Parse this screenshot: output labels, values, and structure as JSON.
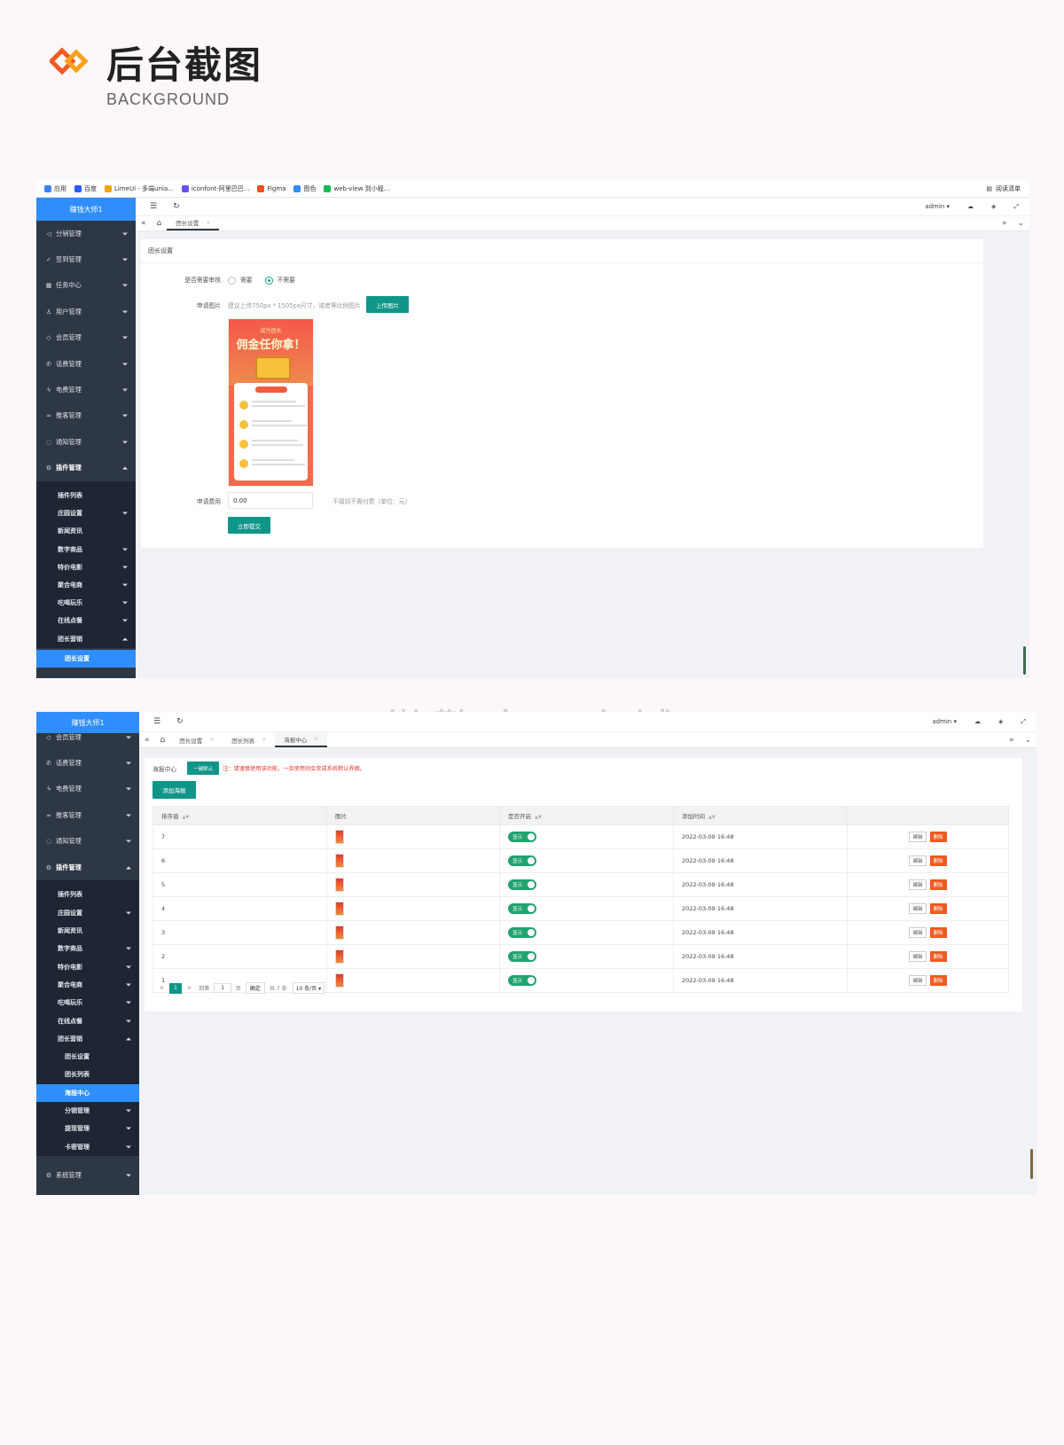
{
  "header": {
    "title": "后台截图",
    "subtitle": "BACKGROUND",
    "accent_colors": [
      "#f15a22",
      "#f7a11a"
    ]
  },
  "browser": {
    "bookmarks": [
      {
        "label": "应用",
        "color": "#3b82f6"
      },
      {
        "label": "百度",
        "color": "#2a59ff"
      },
      {
        "label": "LimeUi - 多端unia...",
        "color": "#f0a500"
      },
      {
        "label": "iconfont-阿里巴巴...",
        "color": "#6c4cf6"
      },
      {
        "label": "Figma",
        "color": "#f24e1e"
      },
      {
        "label": "图色",
        "color": "#2f8efb"
      },
      {
        "label": "web-view 到小程...",
        "color": "#19b955"
      }
    ],
    "reading_list": "阅读清单"
  },
  "shot1": {
    "sidebar": {
      "logo": "赚钱大师1",
      "items": [
        {
          "icon": "send-icon",
          "glyph": "◁",
          "label": "分销管理"
        },
        {
          "icon": "check-icon",
          "glyph": "✓",
          "label": "签到管理"
        },
        {
          "icon": "calendar-icon",
          "glyph": "▦",
          "label": "任务中心"
        },
        {
          "icon": "user-icon",
          "glyph": "♙",
          "label": "用户管理"
        },
        {
          "icon": "diamond-icon",
          "glyph": "◇",
          "label": "会员管理"
        },
        {
          "icon": "phone-icon",
          "glyph": "✆",
          "label": "话费管理"
        },
        {
          "icon": "bolt-icon",
          "glyph": "ϟ",
          "label": "电费管理"
        },
        {
          "icon": "link-icon",
          "glyph": "∞",
          "label": "推客管理"
        },
        {
          "icon": "bell-icon",
          "glyph": "◌",
          "label": "通知管理"
        },
        {
          "icon": "plugin-icon",
          "glyph": "⚙",
          "label": "插件管理"
        }
      ],
      "subitems": [
        {
          "label": "插件列表",
          "arrow": false
        },
        {
          "label": "庄园设置",
          "arrow": true
        },
        {
          "label": "新闻资讯",
          "arrow": false
        },
        {
          "label": "数字商品",
          "arrow": true
        },
        {
          "label": "特价电影",
          "arrow": true
        },
        {
          "label": "聚合电商",
          "arrow": true
        },
        {
          "label": "吃喝玩乐",
          "arrow": true
        },
        {
          "label": "在线点餐",
          "arrow": true
        },
        {
          "label": "团长营销",
          "arrow": "up"
        }
      ],
      "active": "团长设置"
    },
    "topbar": {
      "menu": "☰",
      "refresh": "↻",
      "user": "admin"
    },
    "tabs": [
      {
        "label": "团长设置"
      }
    ],
    "card_title": "团长设置",
    "form": {
      "review_label": "是否需要审核",
      "review_options": [
        "需要",
        "不需要"
      ],
      "review_selected": "不需要",
      "image_label": "申请图片",
      "image_hint": "建议上传750px * 1505px尺寸，或者等比例图片",
      "upload_button": "上传图片",
      "poster": {
        "line1": "成为团长",
        "line2": "佣金任你拿！"
      },
      "fee_label": "申请费用",
      "fee_value": "0.00",
      "fee_hint": "不填则不需付费（单位：元）",
      "submit_button": "立即提交"
    }
  },
  "watermark": "微擎应用商城",
  "shot2": {
    "sidebar": {
      "logo": "赚钱大师1",
      "items": [
        {
          "icon": "diamond-icon",
          "glyph": "◇",
          "label": "会员管理"
        },
        {
          "icon": "phone-icon",
          "glyph": "✆",
          "label": "话费管理"
        },
        {
          "icon": "bolt-icon",
          "glyph": "ϟ",
          "label": "电费管理"
        },
        {
          "icon": "link-icon",
          "glyph": "∞",
          "label": "推客管理"
        },
        {
          "icon": "bell-icon",
          "glyph": "◌",
          "label": "通知管理"
        },
        {
          "icon": "plugin-icon",
          "glyph": "⚙",
          "label": "插件管理"
        }
      ],
      "subitems": [
        {
          "label": "插件列表",
          "arrow": false
        },
        {
          "label": "庄园设置",
          "arrow": true
        },
        {
          "label": "新闻资讯",
          "arrow": false
        },
        {
          "label": "数字商品",
          "arrow": true
        },
        {
          "label": "特价电影",
          "arrow": true
        },
        {
          "label": "聚合电商",
          "arrow": true
        },
        {
          "label": "吃喝玩乐",
          "arrow": true
        },
        {
          "label": "在线点餐",
          "arrow": true
        },
        {
          "label": "团长营销",
          "arrow": "up"
        }
      ],
      "group_items": [
        {
          "label": "团长设置",
          "arrow": false,
          "active": false
        },
        {
          "label": "团长列表",
          "arrow": false,
          "active": false
        },
        {
          "label": "海报中心",
          "arrow": false,
          "active": true
        },
        {
          "label": "分销管理",
          "arrow": true,
          "active": false
        },
        {
          "label": "提现管理",
          "arrow": true,
          "active": false
        },
        {
          "label": "卡密管理",
          "arrow": true,
          "active": false
        }
      ],
      "bottom": {
        "icon": "gear-icon",
        "glyph": "⚙",
        "label": "系统管理"
      }
    },
    "topbar": {
      "menu": "☰",
      "refresh": "↻",
      "user": "admin"
    },
    "tabs": [
      {
        "label": "团长设置"
      },
      {
        "label": "团长列表"
      },
      {
        "label": "海报中心"
      }
    ],
    "header": {
      "title": "海报中心",
      "default_button": "一键默认",
      "note": "注：请谨慎使用该功能，一旦使用则会变成系统默认界面。",
      "add_button": "添加海报"
    },
    "table": {
      "columns": [
        "排序值",
        "图片",
        "是否开启",
        "添加时间",
        ""
      ],
      "rows": [
        {
          "sort": "7",
          "status": "显示",
          "time": "2022-03-09 16:48"
        },
        {
          "sort": "6",
          "status": "显示",
          "time": "2022-03-09 16:48"
        },
        {
          "sort": "5",
          "status": "显示",
          "time": "2022-03-09 16:48"
        },
        {
          "sort": "4",
          "status": "显示",
          "time": "2022-03-09 16:48"
        },
        {
          "sort": "3",
          "status": "显示",
          "time": "2022-03-09 16:48"
        },
        {
          "sort": "2",
          "status": "显示",
          "time": "2022-03-09 16:48"
        },
        {
          "sort": "1",
          "status": "显示",
          "time": "2022-03-09 16:48"
        }
      ],
      "edit_label": "编辑",
      "delete_label": "删除"
    },
    "pager": {
      "prev": "<",
      "current": "1",
      "next": ">",
      "goto_label": "到第",
      "goto_value": "1",
      "page_unit": "页",
      "confirm": "确定",
      "total": "共 7 条",
      "per_page": "10 条/页"
    }
  }
}
